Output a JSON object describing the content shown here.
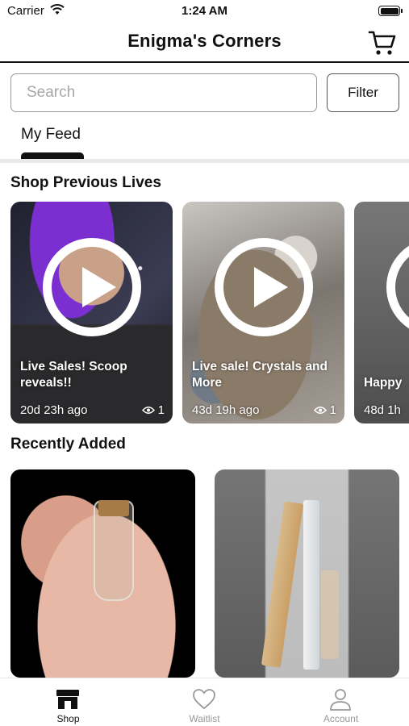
{
  "status_bar": {
    "carrier": "Carrier",
    "time": "1:24 AM"
  },
  "header": {
    "title": "Enigma's Corners",
    "cart_icon": "cart-icon"
  },
  "search": {
    "placeholder": "Search",
    "filter_label": "Filter"
  },
  "tabs": [
    {
      "label": "My Feed",
      "active": true
    }
  ],
  "sections": {
    "previous_lives_title": "Shop Previous Lives",
    "recently_added_title": "Recently Added"
  },
  "previous_lives": [
    {
      "title": "Live Sales! Scoop reveals!!",
      "ago": "20d 23h ago",
      "views": "1"
    },
    {
      "title": "Live sale! Crystals and More",
      "ago": "43d 19h ago",
      "views": "1"
    },
    {
      "title": "Happy",
      "ago": "48d 1h"
    }
  ],
  "recently_added": [
    {
      "icon": "pendant-vial-photo"
    },
    {
      "icon": "crystal-bundle-photo"
    }
  ],
  "tab_bar": [
    {
      "label": "Shop",
      "icon": "store-icon",
      "active": true
    },
    {
      "label": "Waitlist",
      "icon": "heart-icon",
      "active": false
    },
    {
      "label": "Account",
      "icon": "person-icon",
      "active": false
    }
  ],
  "colors": {
    "active": "#111111",
    "inactive": "#999999",
    "divider": "#e9e9e9"
  }
}
